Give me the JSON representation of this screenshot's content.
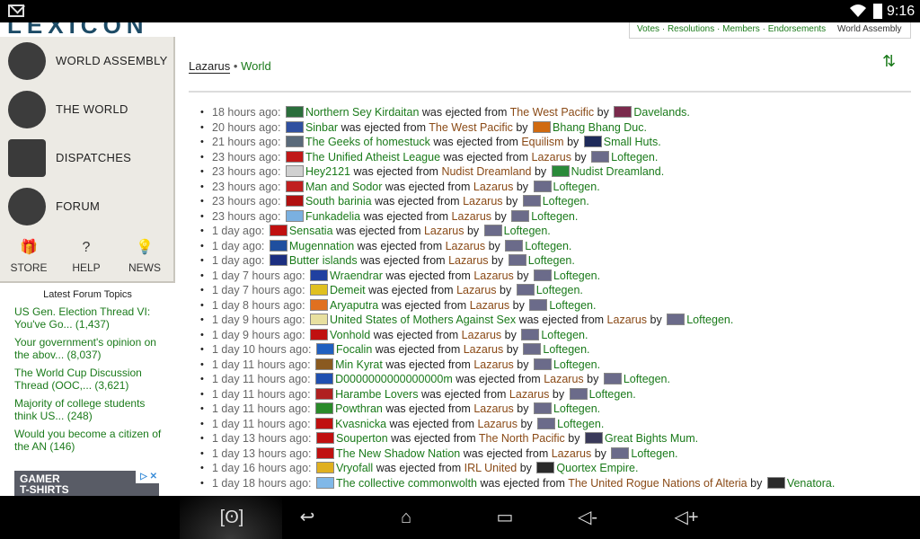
{
  "status_bar": {
    "clock": "9:16"
  },
  "logo": {
    "text": "LEXICON"
  },
  "sidebar": {
    "nav": [
      {
        "label": "WORLD ASSEMBLY",
        "icon": "laurel-icon"
      },
      {
        "label": "THE WORLD",
        "icon": "globe-icon"
      },
      {
        "label": "DISPATCHES",
        "icon": "newspaper-icon"
      },
      {
        "label": "FORUM",
        "icon": "speech-bubble-icon"
      }
    ],
    "mini": [
      {
        "label": "STORE",
        "glyph": "🎁",
        "icon": "gift-icon"
      },
      {
        "label": "HELP",
        "glyph": "?",
        "icon": "question-icon"
      },
      {
        "label": "NEWS",
        "glyph": "💡",
        "icon": "lightbulb-icon"
      }
    ]
  },
  "forum": {
    "heading": "Latest Forum Topics",
    "topics": [
      {
        "title": "US Gen. Election Thread VI: You've Go...",
        "count": "(1,437)"
      },
      {
        "title": "Your government's opinion on the abov...",
        "count": "(8,037)"
      },
      {
        "title": "The World Cup Discussion Thread (OOC,...",
        "count": "(3,621)"
      }
    ],
    "topics_extra": [
      {
        "title": "Majority of college students think US...",
        "count": "(248)"
      },
      {
        "title": "Would you become a citizen of the AN",
        "count": "(146)"
      }
    ]
  },
  "ad": {
    "line1": "GAMER",
    "line2": "T-SHIRTS",
    "badge": "▷ ✕"
  },
  "top_links": {
    "votes": "Votes",
    "resolutions": "Resolutions",
    "members": "Members",
    "endorsements": "Endorsements",
    "world_assembly": "World Assembly"
  },
  "breadcrumb": {
    "region": "Lazarus",
    "separator": "•",
    "world": "World"
  },
  "events": [
    {
      "time": "18 hours ago:",
      "nation": "Northern Sey Kirdaitan",
      "verb": "was ejected from",
      "region": "The West Pacific",
      "by": "by",
      "actor": "Davelands.",
      "flag": "#2b6e3c",
      "aflag": "#7a2a4c"
    },
    {
      "time": "20 hours ago:",
      "nation": "Sinbar",
      "verb": "was ejected from",
      "region": "The West Pacific",
      "by": "by",
      "actor": "Bhang Bhang Duc.",
      "flag": "#3050a0",
      "aflag": "#d06a10"
    },
    {
      "time": "21 hours ago:",
      "nation": "The Geeks of homestuck",
      "verb": "was ejected from",
      "region": "Equilism",
      "by": "by",
      "actor": "Small Huts.",
      "flag": "#5a6a7a",
      "aflag": "#1e2a5a"
    },
    {
      "time": "23 hours ago:",
      "nation": "The Unified Atheist League",
      "verb": "was ejected from",
      "region": "Lazarus",
      "by": "by",
      "actor": "Loftegen.",
      "flag": "#c01818",
      "aflag": "#6b6b8a"
    },
    {
      "time": "23 hours ago:",
      "nation": "Hey2121",
      "verb": "was ejected from",
      "region": "Nudist Dreamland",
      "by": "by",
      "actor": "Nudist Dreamland.",
      "flag": "#d0d0d0",
      "aflag": "#2a8a3a"
    },
    {
      "time": "23 hours ago:",
      "nation": "Man and Sodor",
      "verb": "was ejected from",
      "region": "Lazarus",
      "by": "by",
      "actor": "Loftegen.",
      "flag": "#c02020",
      "aflag": "#6b6b8a"
    },
    {
      "time": "23 hours ago:",
      "nation": "South barinia",
      "verb": "was ejected from",
      "region": "Lazarus",
      "by": "by",
      "actor": "Loftegen.",
      "flag": "#b01010",
      "aflag": "#6b6b8a"
    },
    {
      "time": "23 hours ago:",
      "nation": "Funkadelia",
      "verb": "was ejected from",
      "region": "Lazarus",
      "by": "by",
      "actor": "Loftegen.",
      "flag": "#7ab0e0",
      "aflag": "#6b6b8a"
    },
    {
      "time": "1 day ago:",
      "nation": "Sensatia",
      "verb": "was ejected from",
      "region": "Lazarus",
      "by": "by",
      "actor": "Loftegen.",
      "flag": "#c01010",
      "aflag": "#6b6b8a"
    },
    {
      "time": "1 day ago:",
      "nation": "Mugennation",
      "verb": "was ejected from",
      "region": "Lazarus",
      "by": "by",
      "actor": "Loftegen.",
      "flag": "#1f4f9f",
      "aflag": "#6b6b8a"
    },
    {
      "time": "1 day ago:",
      "nation": "Butter islands",
      "verb": "was ejected from",
      "region": "Lazarus",
      "by": "by",
      "actor": "Loftegen.",
      "flag": "#1c2f80",
      "aflag": "#6b6b8a"
    },
    {
      "time": "1 day 7 hours ago:",
      "nation": "Wraendrar",
      "verb": "was ejected from",
      "region": "Lazarus",
      "by": "by",
      "actor": "Loftegen.",
      "flag": "#2040a0",
      "aflag": "#6b6b8a"
    },
    {
      "time": "1 day 7 hours ago:",
      "nation": "Demeit",
      "verb": "was ejected from",
      "region": "Lazarus",
      "by": "by",
      "actor": "Loftegen.",
      "flag": "#e0c020",
      "aflag": "#6b6b8a"
    },
    {
      "time": "1 day 8 hours ago:",
      "nation": "Aryaputra",
      "verb": "was ejected from",
      "region": "Lazarus",
      "by": "by",
      "actor": "Loftegen.",
      "flag": "#e07020",
      "aflag": "#6b6b8a"
    },
    {
      "time": "1 day 9 hours ago:",
      "nation": "United States of Mothers Against Sex",
      "verb": "was ejected from",
      "region": "Lazarus",
      "by": "by",
      "actor": "Loftegen.",
      "flag": "#e8e0a0",
      "aflag": "#6b6b8a"
    },
    {
      "time": "1 day 9 hours ago:",
      "nation": "Vonhold",
      "verb": "was ejected from",
      "region": "Lazarus",
      "by": "by",
      "actor": "Loftegen.",
      "flag": "#c01010",
      "aflag": "#6b6b8a"
    },
    {
      "time": "1 day 10 hours ago:",
      "nation": "Focalin",
      "verb": "was ejected from",
      "region": "Lazarus",
      "by": "by",
      "actor": "Loftegen.",
      "flag": "#2060c0",
      "aflag": "#6b6b8a"
    },
    {
      "time": "1 day 11 hours ago:",
      "nation": "Min Kyrat",
      "verb": "was ejected from",
      "region": "Lazarus",
      "by": "by",
      "actor": "Loftegen.",
      "flag": "#8a5a20",
      "aflag": "#6b6b8a"
    },
    {
      "time": "1 day 11 hours ago:",
      "nation": "D0000000000000000m",
      "verb": "was ejected from",
      "region": "Lazarus",
      "by": "by",
      "actor": "Loftegen.",
      "flag": "#2050b0",
      "aflag": "#6b6b8a"
    },
    {
      "time": "1 day 11 hours ago:",
      "nation": "Harambe Lovers",
      "verb": "was ejected from",
      "region": "Lazarus",
      "by": "by",
      "actor": "Loftegen.",
      "flag": "#b02020",
      "aflag": "#6b6b8a"
    },
    {
      "time": "1 day 11 hours ago:",
      "nation": "Powthran",
      "verb": "was ejected from",
      "region": "Lazarus",
      "by": "by",
      "actor": "Loftegen.",
      "flag": "#2a8a2a",
      "aflag": "#6b6b8a"
    },
    {
      "time": "1 day 11 hours ago:",
      "nation": "Kvasnicka",
      "verb": "was ejected from",
      "region": "Lazarus",
      "by": "by",
      "actor": "Loftegen.",
      "flag": "#c01010",
      "aflag": "#6b6b8a"
    },
    {
      "time": "1 day 13 hours ago:",
      "nation": "Souperton",
      "verb": "was ejected from",
      "region": "The North Pacific",
      "by": "by",
      "actor": "Great Bights Mum.",
      "flag": "#c01010",
      "aflag": "#3a3a5a"
    },
    {
      "time": "1 day 13 hours ago:",
      "nation": "The New Shadow Nation",
      "verb": "was ejected from",
      "region": "Lazarus",
      "by": "by",
      "actor": "Loftegen.",
      "flag": "#c01010",
      "aflag": "#6b6b8a"
    },
    {
      "time": "1 day 16 hours ago:",
      "nation": "Vryofall",
      "verb": "was ejected from",
      "region": "IRL United",
      "by": "by",
      "actor": "Quortex Empire.",
      "flag": "#e0b020",
      "aflag": "#2a2a2a"
    },
    {
      "time": "1 day 18 hours ago:",
      "nation": "The collective commonwolth",
      "verb": "was ejected from",
      "region": "The United Rogue Nations of Alteria",
      "by": "by",
      "actor": "Venatora.",
      "flag": "#80b8e8",
      "aflag": "#2a2a2a"
    }
  ],
  "android_nav": [
    {
      "glyph": "[ʘ]",
      "name": "screenshot-button"
    },
    {
      "glyph": "↩",
      "name": "back-button"
    },
    {
      "glyph": "⌂",
      "name": "home-button"
    },
    {
      "glyph": "▭",
      "name": "recents-button"
    },
    {
      "glyph": "◁-",
      "name": "volume-down-button"
    },
    {
      "glyph": "◁+",
      "name": "volume-up-button"
    }
  ]
}
